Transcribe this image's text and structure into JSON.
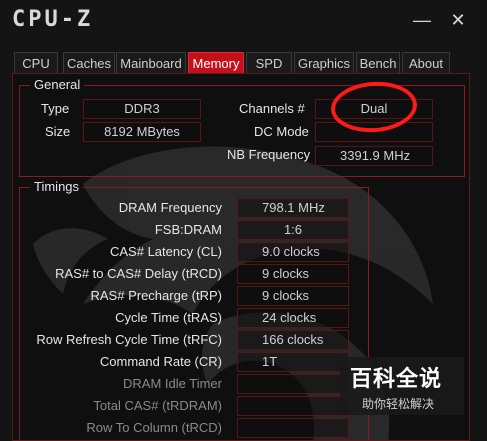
{
  "app": {
    "title": "CPU-Z"
  },
  "window": {
    "minimize": "—",
    "close": "✕"
  },
  "tabs": [
    {
      "label": "CPU"
    },
    {
      "label": "Caches"
    },
    {
      "label": "Mainboard"
    },
    {
      "label": "Memory",
      "active": true
    },
    {
      "label": "SPD"
    },
    {
      "label": "Graphics"
    },
    {
      "label": "Bench"
    },
    {
      "label": "About"
    }
  ],
  "general": {
    "title": "General",
    "type_label": "Type",
    "type_value": "DDR3",
    "size_label": "Size",
    "size_value": "8192 MBytes",
    "channels_label": "Channels #",
    "channels_value": "Dual",
    "dc_mode_label": "DC Mode",
    "dc_mode_value": "",
    "nb_freq_label": "NB Frequency",
    "nb_freq_value": "3391.9 MHz"
  },
  "timings": {
    "title": "Timings",
    "rows": [
      {
        "label": "DRAM Frequency",
        "value": "798.1 MHz"
      },
      {
        "label": "FSB:DRAM",
        "value": "1:6"
      },
      {
        "label": "CAS# Latency (CL)",
        "value": "9.0 clocks"
      },
      {
        "label": "RAS# to CAS# Delay (tRCD)",
        "value": "9 clocks"
      },
      {
        "label": "RAS# Precharge (tRP)",
        "value": "9 clocks"
      },
      {
        "label": "Cycle Time (tRAS)",
        "value": "24 clocks"
      },
      {
        "label": "Row Refresh Cycle Time (tRFC)",
        "value": "166 clocks"
      },
      {
        "label": "Command Rate (CR)",
        "value": "1T"
      },
      {
        "label": "DRAM Idle Timer",
        "value": "",
        "dim": true
      },
      {
        "label": "Total CAS# (tRDRAM)",
        "value": "",
        "dim": true
      },
      {
        "label": "Row To Column (tRCD)",
        "value": "",
        "dim": true
      }
    ]
  },
  "watermark": {
    "main": "百科全说",
    "sub": "助你轻松解决"
  },
  "colors": {
    "accent": "#c4101b",
    "annotation": "#ff1a1a"
  }
}
